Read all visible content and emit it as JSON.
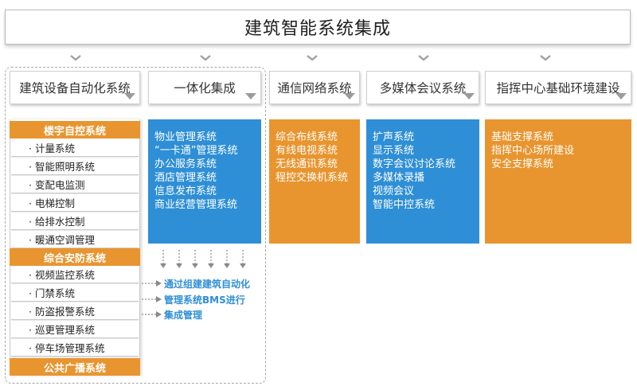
{
  "title": "建筑智能系统集成",
  "categories": [
    {
      "label": "建筑设备自动化系统"
    },
    {
      "label": "一体化集成"
    },
    {
      "label": "通信网络系统"
    },
    {
      "label": "多媒体会议系统"
    },
    {
      "label": "指挥中心基础环境建设"
    }
  ],
  "bas_groups": {
    "g1_header": "楼宇自控系统",
    "g1_items": [
      "· 计量系统",
      "· 智能照明系统",
      "· 变配电监测",
      "· 电梯控制",
      "· 给排水控制",
      "· 暖通空调管理"
    ],
    "g2_header": "综合安防系统",
    "g2_items": [
      "· 视频监控系统",
      "· 门禁系统",
      "· 防盗报警系统",
      "· 巡更管理系统",
      "· 停车场管理系统"
    ],
    "g3_header": "公共广播系统"
  },
  "integration": {
    "items": [
      "物业管理系统",
      "“一卡通”管理系统",
      "办公服务系统",
      "酒店管理系统",
      "信息发布系统",
      "商业经营管理系统"
    ]
  },
  "network": {
    "items": [
      "综合布线系统",
      "有线电视系统",
      "无线通讯系统",
      "程控交换机系统"
    ]
  },
  "multimedia": {
    "items": [
      "扩声系统",
      "显示系统",
      "数字会议讨论系统",
      "多媒体录播",
      "视频会议",
      "智能中控系统"
    ]
  },
  "command": {
    "items": [
      "基础支撑系统",
      "指挥中心场所建设",
      "安全支撑系统"
    ]
  },
  "bms_note": [
    "通过组建建筑自动化",
    "管理系统BMS进行",
    "集成管理"
  ],
  "colors": {
    "orange": "#e8952f",
    "blue": "#2e8fd6"
  }
}
